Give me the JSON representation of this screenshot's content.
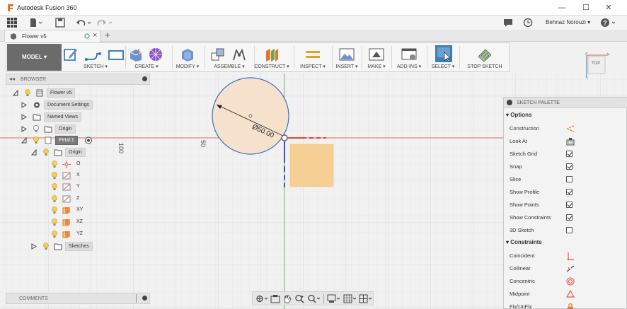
{
  "window": {
    "title": "Autodesk Fusion 360",
    "minimize": "—",
    "maximize": "☐",
    "close": "✕"
  },
  "quick_access": {
    "user_name": "Behnaz Norouzi ▾",
    "help": "?"
  },
  "document_tab": {
    "label": "Flower v5",
    "close": "×",
    "new_tab": "+"
  },
  "toolbar": {
    "workspace": "MODEL ▾",
    "groups": [
      {
        "label": "SKETCH ▾"
      },
      {
        "label": "CREATE ▾"
      },
      {
        "label": "MODIFY ▾"
      },
      {
        "label": "ASSEMBLE ▾"
      },
      {
        "label": "CONSTRUCT ▾"
      },
      {
        "label": "INSPECT ▾"
      },
      {
        "label": "INSERT ▾"
      },
      {
        "label": "MAKE ▾"
      },
      {
        "label": "ADD-INS ▾"
      },
      {
        "label": "SELECT ▾"
      },
      {
        "label": "STOP SKETCH"
      }
    ]
  },
  "browser": {
    "header": "BROWSER",
    "items": [
      {
        "label": "Flower v5"
      },
      {
        "label": "Document Settings"
      },
      {
        "label": "Named Views"
      },
      {
        "label": "Origin"
      },
      {
        "label": "Petal:1"
      },
      {
        "label": "Origin"
      },
      {
        "label": "O"
      },
      {
        "label": "X"
      },
      {
        "label": "Y"
      },
      {
        "label": "Z"
      },
      {
        "label": "XY"
      },
      {
        "label": "XZ"
      },
      {
        "label": "YZ"
      },
      {
        "label": "Sketches"
      }
    ]
  },
  "comments": {
    "header": "COMMENTS"
  },
  "canvas": {
    "ruler_labels": [
      "100",
      "50"
    ],
    "dimension": "Ø50.00",
    "view_cube_label": "TOP"
  },
  "sketch_palette": {
    "header": "SKETCH PALETTE",
    "options_title": "Options",
    "options": [
      {
        "label": "Construction",
        "type": "icon",
        "icon": "construction-icon"
      },
      {
        "label": "Look At",
        "type": "icon",
        "icon": "look-at-icon"
      },
      {
        "label": "Sketch Grid",
        "type": "checkbox",
        "checked": true
      },
      {
        "label": "Snap",
        "type": "checkbox",
        "checked": true
      },
      {
        "label": "Slice",
        "type": "checkbox",
        "checked": false
      },
      {
        "label": "Show Profile",
        "type": "checkbox",
        "checked": true
      },
      {
        "label": "Show Points",
        "type": "checkbox",
        "checked": true
      },
      {
        "label": "Show Constraints",
        "type": "checkbox",
        "checked": true
      },
      {
        "label": "3D Sketch",
        "type": "checkbox",
        "checked": false
      }
    ],
    "constraints_title": "Constraints",
    "constraints": [
      {
        "label": "Coincident"
      },
      {
        "label": "Collinear"
      },
      {
        "label": "Concentric"
      },
      {
        "label": "Midpoint"
      },
      {
        "label": "Fix/UnFix"
      }
    ]
  },
  "colors": {
    "accent_blue": "#3a6fc4",
    "circle_fill": "#f6e2cc",
    "rect_fill": "#f5cf93",
    "axis_red": "#e05a4a",
    "axis_green": "#5aa84a"
  }
}
